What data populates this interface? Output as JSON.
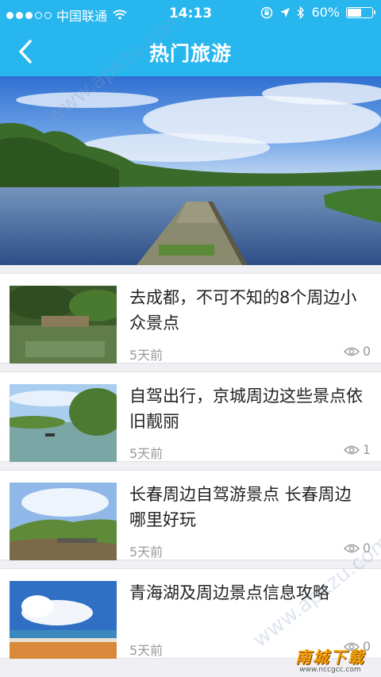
{
  "status_bar": {
    "carrier": "中国联通",
    "time": "14:13",
    "battery": "60%",
    "battery_level": 0.6
  },
  "nav": {
    "title": "热门旅游"
  },
  "articles": [
    {
      "title": "去成都，不可不知的8个周边小众景点",
      "time": "5天前",
      "views": "0"
    },
    {
      "title": "自驾出行，京城周边这些景点依旧靓丽",
      "time": "5天前",
      "views": "1"
    },
    {
      "title": "长春周边自驾游景点 长春周边哪里好玩",
      "time": "5天前",
      "views": "0"
    },
    {
      "title": "青海湖及周边景点信息攻略",
      "time": "5天前",
      "views": "0"
    }
  ],
  "watermark": {
    "text": "www.apkzu.com"
  },
  "logo": {
    "main": "南城下载",
    "sub": "www.nccgcc.com"
  },
  "colors": {
    "accent": "#27b6ee",
    "background": "#efeff4",
    "text": "#222222",
    "meta": "#9a9a9a"
  }
}
